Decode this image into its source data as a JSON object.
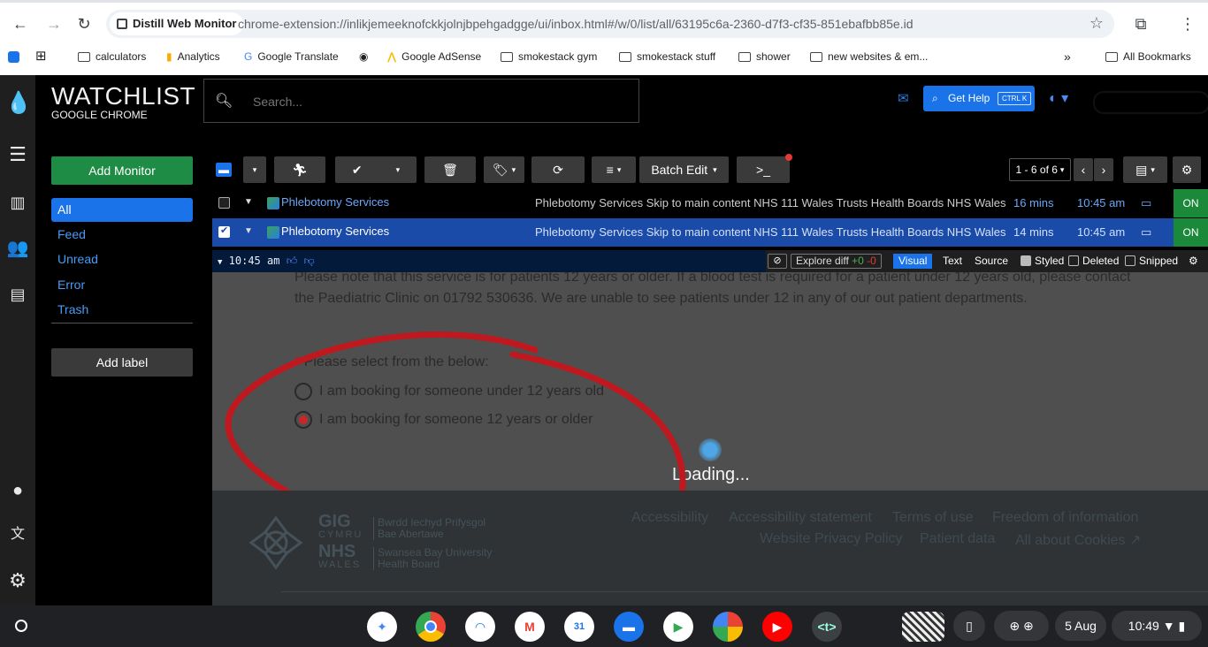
{
  "browser": {
    "site_chip": "Distill Web Monitor",
    "url": "chrome-extension://inlikjemeeknofckkjolnjbpehgadgge/ui/inbox.html#/w/0/list/all/63195c6a-2360-d7f3-cf35-851ebafbb85e.id",
    "bookmarks": [
      "calculators",
      "Analytics",
      "Google Translate",
      "Google AdSense",
      "smokestack gym",
      "smokestack stuff",
      "shower",
      "new websites & em...",
      "All Bookmarks"
    ],
    "more_bookmarks": "»"
  },
  "app": {
    "brand_title": "WATCHLIST",
    "brand_subtitle": "GOOGLE CHROME",
    "search_placeholder": "Search...",
    "get_help_label": "Get Help",
    "get_help_shortcut": "CTRL K"
  },
  "sidebar": {
    "add_monitor": "Add Monitor",
    "items": [
      {
        "label": "All",
        "active": true
      },
      {
        "label": "Feed"
      },
      {
        "label": "Unread"
      },
      {
        "label": "Error"
      },
      {
        "label": "Trash"
      }
    ],
    "add_label": "Add label"
  },
  "toolbar": {
    "batch_edit": "Batch Edit",
    "console_label": ">_",
    "pagination": "1 - 6 of 6"
  },
  "rows": [
    {
      "name": "Phlebotomy Services",
      "snippet": "Phlebotomy Services Skip to main content NHS 111 Wales Trusts Health Boards NHS Wales",
      "ago": "16 mins",
      "time": "10:45 am",
      "status": "ON",
      "checked": false
    },
    {
      "name": "Phlebotomy Services",
      "snippet": "Phlebotomy Services Skip to main content NHS 111 Wales Trusts Health Boards NHS Wales",
      "ago": "14 mins",
      "time": "10:45 am",
      "status": "ON",
      "checked": true
    }
  ],
  "detail": {
    "time": "10:45 am",
    "explore_diff": "Explore diff",
    "added": "+0",
    "removed": "-0",
    "tabs": [
      "Visual",
      "Text",
      "Source"
    ],
    "active_tab": "Visual",
    "toggles": [
      {
        "label": "Styled",
        "checked": true
      },
      {
        "label": "Deleted",
        "checked": false
      },
      {
        "label": "Snipped",
        "checked": false
      }
    ]
  },
  "preview": {
    "notice_line1": "Please note that this service is for patients 12 years or older. If a blood test is required for a patient under 12 years old, please contact",
    "notice_line2": "the Paediatric Clinic on 01792 530636. We are unable to see patients under 12 in any of our out patient departments.",
    "question_required": "*",
    "question": "Please select from the below:",
    "options": [
      {
        "label": "I am booking for someone under 12 years old",
        "selected": false
      },
      {
        "label": "I am booking for someone 12 years or older",
        "selected": true
      }
    ],
    "loading": "Loading...",
    "footer_links_row1": [
      "Accessibility",
      "Accessibility statement",
      "Terms of use",
      "Freedom of information"
    ],
    "footer_links_row2": [
      "Website Privacy Policy",
      "Patient data",
      "All about Cookies"
    ],
    "logo": {
      "gig": "GIG",
      "cymru": "CYMRU",
      "nhs": "NHS",
      "wales": "WALES",
      "bwrdd1": "Bwrdd Iechyd Prifysgol",
      "bwrdd2": "Bae Abertawe",
      "board1": "Swansea Bay University",
      "board2": "Health Board"
    }
  },
  "taskbar": {
    "date": "5 Aug",
    "time": "10:49"
  },
  "colors": {
    "accent": "#1a73e8",
    "add_monitor": "#1e8c44",
    "status_on": "#1a8a3a",
    "annotation": "#c0181f"
  }
}
